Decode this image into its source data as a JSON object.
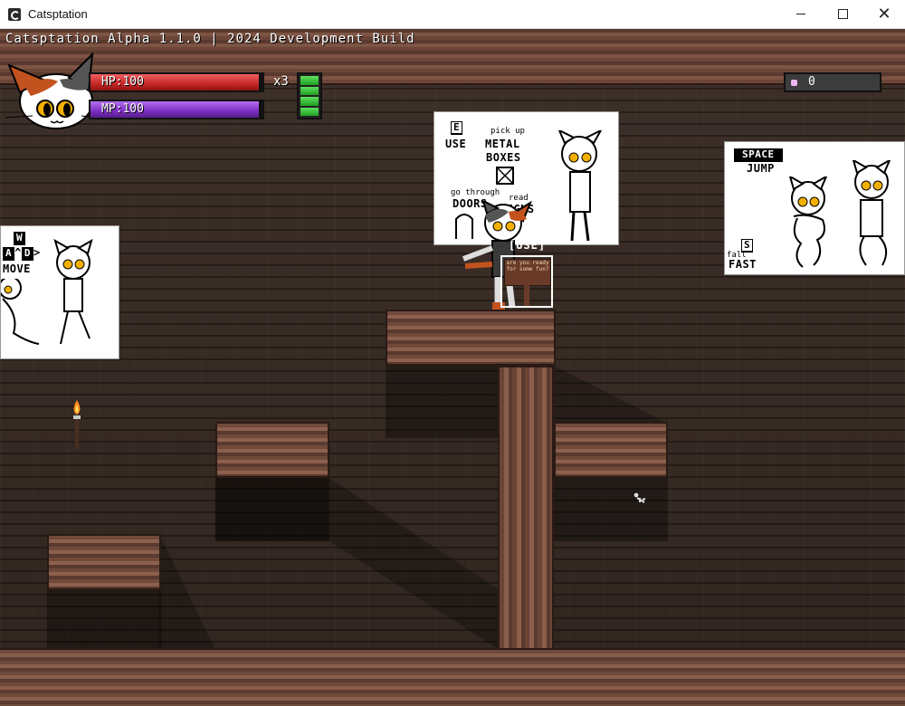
{
  "window": {
    "title": "Catsptation",
    "controls": [
      "minimize",
      "maximize",
      "close"
    ]
  },
  "game": {
    "build_label": "Catsptation Alpha 1.1.0 | 2024 Development Build",
    "hud": {
      "hp_label": "HP:100",
      "mp_label": "MP:100",
      "lives_label": "x3",
      "stamina_segments": 4,
      "gem_count": "0",
      "colors": {
        "hp": "#c42626",
        "mp": "#7c2ec2",
        "stamina": "#2fbf2f",
        "gem": "#f0b8f0"
      }
    },
    "signs": {
      "move": {
        "up_key": "W",
        "left_key": "A",
        "down_key": "^",
        "right_key": "D",
        "label": "MOVE"
      },
      "use": {
        "use_key": "E",
        "use_label": "USE",
        "pickup_small": "pick up",
        "pickup_label_1": "METAL",
        "pickup_label_2": "BOXES",
        "doors_small": "go through",
        "doors_label": "DOORS",
        "read_small": "read",
        "read_label": "SIGNS"
      },
      "jump": {
        "jump_key": "SPACE",
        "jump_label": "JUMP",
        "fall_small": "fall",
        "fall_key": "S",
        "fast_label": "FAST"
      }
    },
    "interact_prompt": "[USE]",
    "signpost_text": "are you ready for some fun?"
  }
}
